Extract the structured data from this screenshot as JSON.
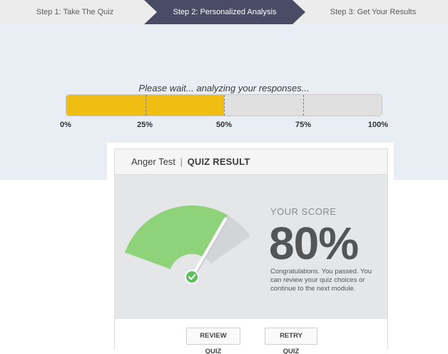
{
  "steps": [
    {
      "label": "Step 1: Take The Quiz"
    },
    {
      "label": "Step 2: Personalized Analysis"
    },
    {
      "label": "Step 3: Get Your Results"
    }
  ],
  "active_step_color": "#4a4c66",
  "analysis": {
    "wait_text": "Please wait... analyzing your responses...",
    "progress": 0.5,
    "progress_color": "#f0bd12",
    "tick_labels": [
      "0%",
      "25%",
      "50%",
      "75%",
      "100%"
    ]
  },
  "result": {
    "quiz_name": "Anger Test",
    "separator": "|",
    "header_title": "QUIZ RESULT",
    "score_caption": "YOUR SCORE",
    "score": "80%",
    "score_fraction": 0.8,
    "gauge_color": "#8ed27a",
    "message": "Congratulations. You passed. You can review your quiz choices or continue to the next module.",
    "review_label": "REVIEW QUIZ",
    "retry_label": "RETRY QUIZ",
    "check_icon": "check-icon"
  }
}
